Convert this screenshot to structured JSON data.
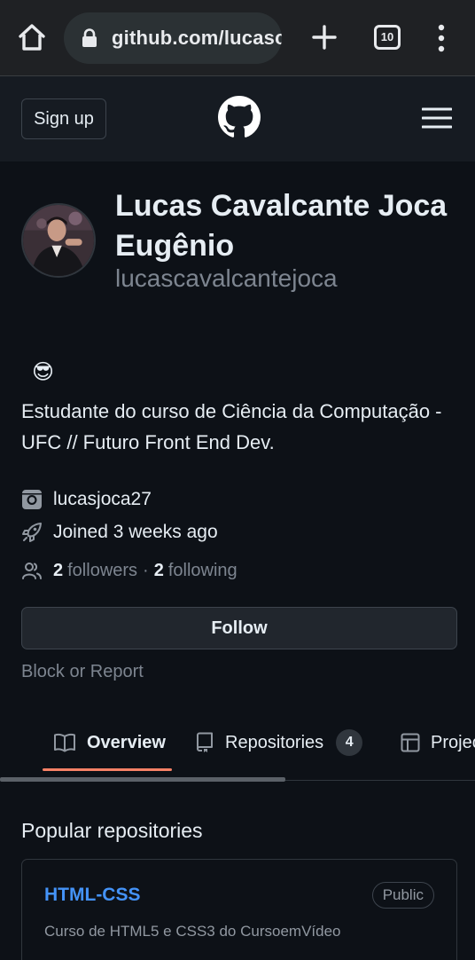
{
  "browser": {
    "url": "github.com/lucascavalcantejoca",
    "tab_count": "10"
  },
  "header": {
    "signup_label": "Sign up"
  },
  "profile": {
    "full_name": "Lucas Cavalcante Joca Eugênio",
    "username": "lucascavalcantejoca",
    "status_emoji": "😎",
    "bio": "Estudante do curso de Ciência da Computação - UFC // Futuro Front End Dev.",
    "instagram": "lucasjoca27",
    "joined": "Joined 3 weeks ago",
    "followers_count": "2",
    "followers_label": "followers",
    "separator": "·",
    "following_count": "2",
    "following_label": "following",
    "follow_button": "Follow",
    "block_report": "Block or Report"
  },
  "tabs": [
    {
      "label": "Overview",
      "icon": "book-icon",
      "selected": true
    },
    {
      "label": "Repositories",
      "icon": "repo-icon",
      "count": "4"
    },
    {
      "label": "Projects",
      "icon": "table-icon"
    }
  ],
  "popular": {
    "title": "Popular repositories",
    "repos": [
      {
        "name": "HTML-CSS",
        "visibility": "Public",
        "description": "Curso de HTML5 e CSS3 do CursoemVídeo"
      }
    ]
  },
  "colors": {
    "background": "#0d1117",
    "header": "#161b22",
    "link": "#4493f8",
    "tab_underline": "#f78166"
  }
}
